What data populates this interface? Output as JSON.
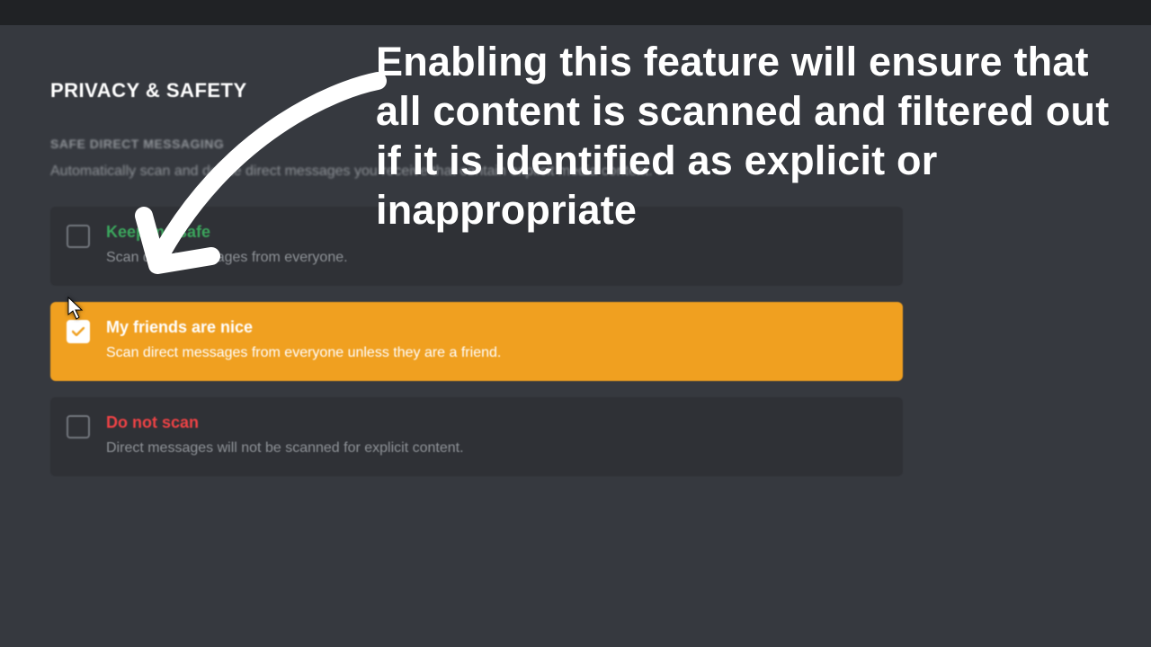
{
  "header": {
    "title": "PRIVACY & SAFETY"
  },
  "safe_dm": {
    "subtitle": "SAFE DIRECT MESSAGING",
    "description": "Automatically scan and delete direct messages you receive that contain explicit media content."
  },
  "options": {
    "keep_safe": {
      "title": "Keep me safe",
      "desc": "Scan direct messages from everyone.",
      "checked": false
    },
    "friends_nice": {
      "title": "My friends are nice",
      "desc": "Scan direct messages from everyone unless they are a friend.",
      "checked": true
    },
    "do_not_scan": {
      "title": "Do not scan",
      "desc": "Direct messages will not be scanned for explicit content.",
      "checked": false
    }
  },
  "annotation": {
    "text": "Enabling this feature will ensure that all content is scanned and filtered out if it is identified as explicit or inappropriate"
  },
  "colors": {
    "bg": "#36393f",
    "card": "#2f3136",
    "accent": "#f0a020",
    "green": "#3ba55c",
    "red": "#ed4245"
  }
}
